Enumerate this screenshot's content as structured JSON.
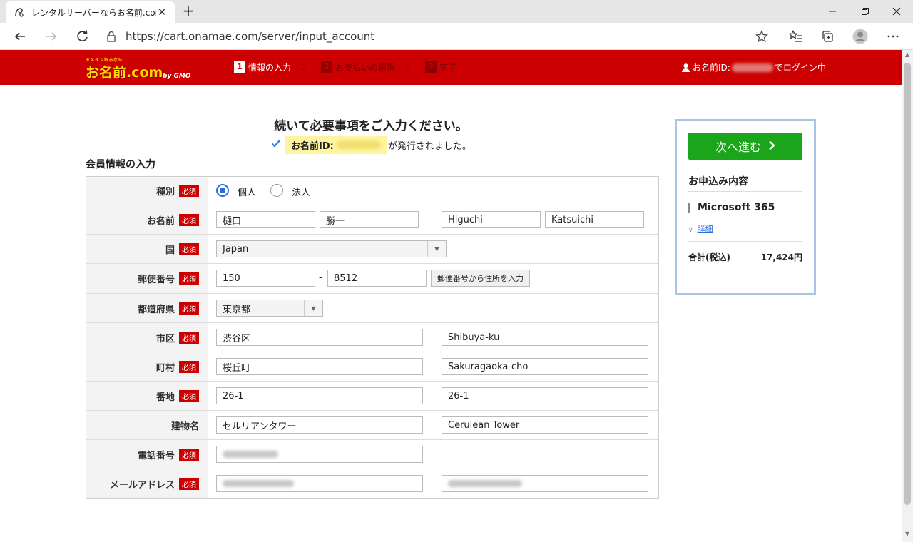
{
  "browser": {
    "tab_title": "レンタルサーバーならお名前.com",
    "url": "https://cart.onamae.com/server/input_account"
  },
  "header": {
    "logo_small": "ドメイン取るなら",
    "logo_main": "お名前.com",
    "logo_gmo": "by GMO",
    "steps": [
      {
        "num": "1",
        "label": "情報の入力",
        "active": true
      },
      {
        "num": "2",
        "label": "お支払いの選択",
        "active": false
      },
      {
        "num": "3",
        "label": "完了",
        "active": false
      }
    ],
    "login_prefix": "お名前ID:",
    "login_suffix": "でログイン中"
  },
  "main": {
    "heading": "続いて必要事項をご入力ください。",
    "issued_label": "お名前ID:",
    "issued_suffix": "が発行されました。",
    "section_title": "会員情報の入力",
    "required_label": "必須"
  },
  "form": {
    "type": {
      "label": "種別",
      "option_personal": "個人",
      "option_corporate": "法人",
      "selected": "個人"
    },
    "name": {
      "label": "お名前",
      "last_kanji": "樋口",
      "first_kanji": "勝一",
      "last_roman": "Higuchi",
      "first_roman": "Katsuichi"
    },
    "country": {
      "label": "国",
      "value": "Japan"
    },
    "zip": {
      "label": "郵便番号",
      "part1": "150",
      "dash": "-",
      "part2": "8512",
      "lookup_button": "郵便番号から住所を入力"
    },
    "prefecture": {
      "label": "都道府県",
      "value": "東京都"
    },
    "city": {
      "label": "市区",
      "jp": "渋谷区",
      "en": "Shibuya-ku"
    },
    "town": {
      "label": "町村",
      "jp": "桜丘町",
      "en": "Sakuragaoka-cho"
    },
    "block": {
      "label": "番地",
      "jp": "26-1",
      "en": "26-1"
    },
    "building": {
      "label": "建物名",
      "jp": "セルリアンタワー",
      "en": "Cerulean Tower"
    },
    "phone": {
      "label": "電話番号"
    },
    "email": {
      "label": "メールアドレス"
    }
  },
  "side": {
    "next_button": "次へ進む",
    "order_title": "お申込み内容",
    "product": "Microsoft 365",
    "detail_link": "詳細",
    "total_label": "合計(税込)",
    "total_value": "17,424円"
  },
  "colors": {
    "brand_red": "#cc0000",
    "next_green": "#1aa51a",
    "panel_border": "#aac4e6",
    "highlight_yellow": "#fff5a0"
  }
}
